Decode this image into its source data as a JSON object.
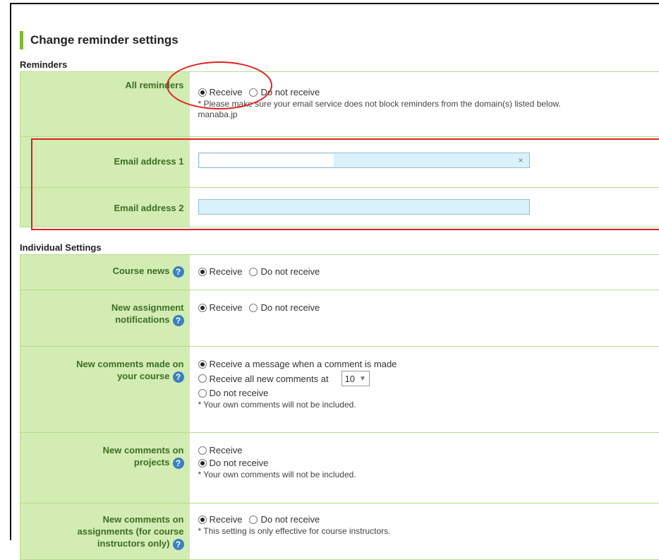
{
  "page_title": "Change reminder settings",
  "accent_color": "#7dbb30",
  "reminders": {
    "section_label": "Reminders",
    "all_reminders": {
      "label": "All reminders",
      "options": [
        "Receive",
        "Do not receive"
      ],
      "selected": "Receive",
      "note": "* Please make sure your email service does not block reminders from the domain(s) listed below.",
      "domain": "manaba.jp"
    },
    "email1": {
      "label": "Email address 1",
      "value": "",
      "clear_icon": "×"
    },
    "email2": {
      "label": "Email address 2",
      "value": ""
    }
  },
  "individual": {
    "section_label": "Individual Settings",
    "course_news": {
      "label": "Course news",
      "options": [
        "Receive",
        "Do not receive"
      ],
      "selected": "Receive"
    },
    "new_assignment": {
      "label_line1": "New assignment",
      "label_line2": "notifications",
      "options": [
        "Receive",
        "Do not receive"
      ],
      "selected": "Receive"
    },
    "new_comments_course": {
      "label_line1": "New comments made on",
      "label_line2": "your course",
      "option1": "Receive a message when a comment is made",
      "option2": "Receive all new comments at",
      "option2_select_value": "10",
      "option3": "Do not receive",
      "note": "* Your own comments will not be included.",
      "selected": 1
    },
    "new_comments_projects": {
      "label_line1": "New comments on",
      "label_line2": "projects",
      "option1": "Receive",
      "option2": "Do not receive",
      "note": "* Your own comments will not be included.",
      "selected": 2
    },
    "new_comments_assignments": {
      "label_line1": "New comments on",
      "label_line2": "assignments (for course",
      "label_line3": "instructors only)",
      "options": [
        "Receive",
        "Do not receive"
      ],
      "selected": "Receive",
      "note": "* This setting is only effective for course instructors."
    }
  },
  "help_icon_glyph": "?"
}
